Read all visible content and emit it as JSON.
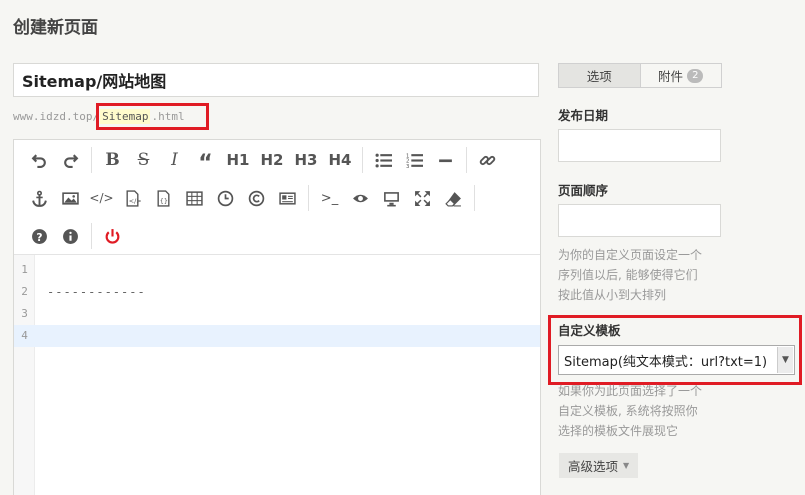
{
  "header": {
    "title": "创建新页面"
  },
  "title_field": {
    "value": "Sitemap/网站地图"
  },
  "url": {
    "prefix": "www.idzd.top/",
    "slug": "Sitemap",
    "suffix": ".html"
  },
  "editor": {
    "toolbar_labels": {
      "h1": "H1",
      "h2": "H2",
      "h3": "H3",
      "h4": "H4"
    },
    "lines": [
      {
        "num": "1",
        "text": ""
      },
      {
        "num": "2",
        "text": "------------"
      },
      {
        "num": "3",
        "text": ""
      },
      {
        "num": "4",
        "text": ""
      }
    ]
  },
  "sidebar": {
    "tabs": {
      "options": "选项",
      "attachments": "附件",
      "attachments_count": "2"
    },
    "publish_date_label": "发布日期",
    "order_label": "页面顺序",
    "order_help": [
      "为你的自定义页面设定一个",
      "序列值以后, 能够使得它们",
      "按此值从小到大排列"
    ],
    "template_label": "自定义模板",
    "template_selected": "Sitemap(纯文本模式：url?txt=1)",
    "template_help": [
      "如果你为此页面选择了一个",
      "自定义模板, 系统将按照你",
      "选择的模板文件展现它"
    ],
    "advanced_label": "高级选项"
  },
  "colors": {
    "highlight_box": "#e01b24",
    "power_icon": "#e01b24",
    "active_line": "#e8f2fe"
  }
}
